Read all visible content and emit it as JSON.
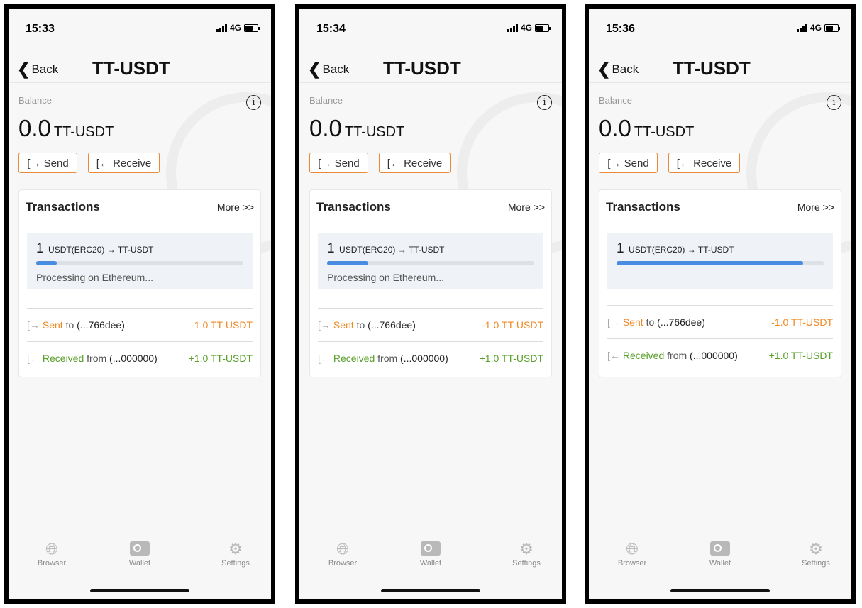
{
  "colors": {
    "accent": "#f08a24",
    "received": "#5aa02c",
    "progress": "#4a8ce0"
  },
  "screens": [
    {
      "status": {
        "time": "15:33",
        "network": "4G"
      },
      "nav": {
        "back_label": "Back",
        "title": "TT-USDT"
      },
      "wallet": {
        "balance_label": "Balance",
        "balance_value": "0.0",
        "balance_unit": "TT-USDT",
        "send_label": "Send",
        "receive_label": "Receive"
      },
      "transactions": {
        "title": "Transactions",
        "more_label": "More >>",
        "processing": {
          "amount": "1",
          "pair": "USDT(ERC20) → TT-USDT",
          "progress": 0.1,
          "status": "Processing on Ethereum..."
        },
        "sent": {
          "label": "Sent",
          "prep": "to",
          "address": "(...766dee)",
          "amount": "-1.0 TT-USDT"
        },
        "received": {
          "label": "Received",
          "prep": "from",
          "address": "(...000000)",
          "amount": "+1.0 TT-USDT"
        }
      },
      "tabbar": {
        "browser": "Browser",
        "wallet": "Wallet",
        "settings": "Settings"
      }
    },
    {
      "status": {
        "time": "15:34",
        "network": "4G"
      },
      "nav": {
        "back_label": "Back",
        "title": "TT-USDT"
      },
      "wallet": {
        "balance_label": "Balance",
        "balance_value": "0.0",
        "balance_unit": "TT-USDT",
        "send_label": "Send",
        "receive_label": "Receive"
      },
      "transactions": {
        "title": "Transactions",
        "more_label": "More >>",
        "processing": {
          "amount": "1",
          "pair": "USDT(ERC20) → TT-USDT",
          "progress": 0.2,
          "status": "Processing on Ethereum..."
        },
        "sent": {
          "label": "Sent",
          "prep": "to",
          "address": "(...766dee)",
          "amount": "-1.0 TT-USDT"
        },
        "received": {
          "label": "Received",
          "prep": "from",
          "address": "(...000000)",
          "amount": "+1.0 TT-USDT"
        }
      },
      "tabbar": {
        "browser": "Browser",
        "wallet": "Wallet",
        "settings": "Settings"
      }
    },
    {
      "status": {
        "time": "15:36",
        "network": "4G"
      },
      "nav": {
        "back_label": "Back",
        "title": "TT-USDT"
      },
      "wallet": {
        "balance_label": "Balance",
        "balance_value": "0.0",
        "balance_unit": "TT-USDT",
        "send_label": "Send",
        "receive_label": "Receive"
      },
      "transactions": {
        "title": "Transactions",
        "more_label": "More >>",
        "processing": {
          "amount": "1",
          "pair": "USDT(ERC20) → TT-USDT",
          "progress": 0.9,
          "status": ""
        },
        "sent": {
          "label": "Sent",
          "prep": "to",
          "address": "(...766dee)",
          "amount": "-1.0 TT-USDT"
        },
        "received": {
          "label": "Received",
          "prep": "from",
          "address": "(...000000)",
          "amount": "+1.0 TT-USDT"
        }
      },
      "tabbar": {
        "browser": "Browser",
        "wallet": "Wallet",
        "settings": "Settings"
      }
    }
  ]
}
